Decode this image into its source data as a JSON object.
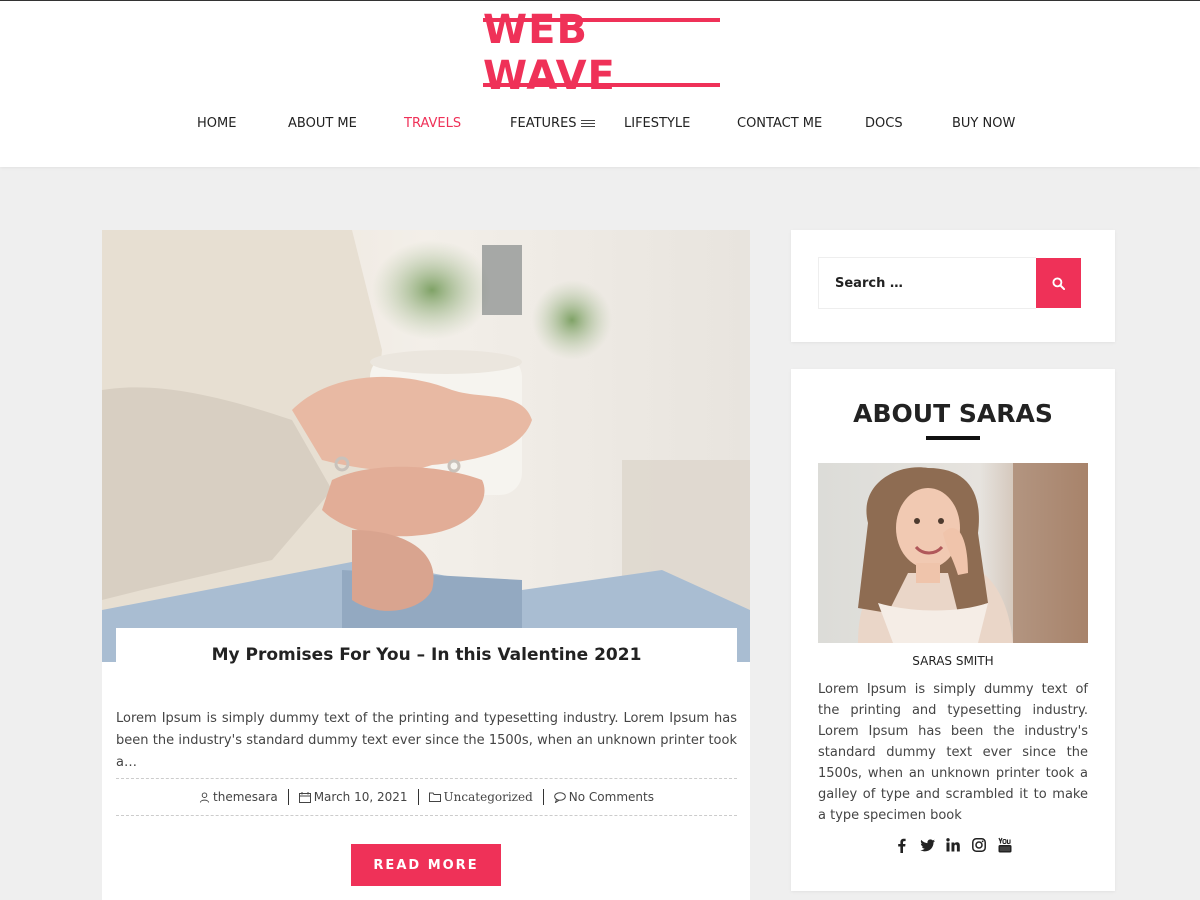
{
  "site": {
    "logo": "WEB WAVE",
    "accent_color": "#ef3158"
  },
  "nav": {
    "items": [
      {
        "label": "HOME"
      },
      {
        "label": "ABOUT ME"
      },
      {
        "label": "TRAVELS",
        "active": true
      },
      {
        "label": "FEATURES",
        "icon": "menu-lines-icon"
      },
      {
        "label": "LIFESTYLE"
      },
      {
        "label": "CONTACT ME"
      },
      {
        "label": "DOCS"
      },
      {
        "label": "BUY NOW"
      }
    ]
  },
  "post": {
    "image_alt": "woman-holding-cup-photo",
    "title": "My Promises For You – In this Valentine 2021",
    "excerpt": "Lorem Ipsum is simply dummy text of the printing and typesetting industry. Lorem Ipsum has been the industry's standard dummy text ever since the 1500s, when an unknown printer took a…",
    "meta": {
      "author": "themesara",
      "date": "March 10, 2021",
      "category": "Uncategorized",
      "comments": "No Comments"
    },
    "read_more": "READ MORE"
  },
  "sidebar": {
    "search": {
      "placeholder": "Search …",
      "button_icon": "search-icon"
    },
    "about": {
      "title": "ABOUT SARAS",
      "name": "SARAS SMITH",
      "text": "Lorem Ipsum is simply dummy text of the printing and typesetting industry. Lorem Ipsum has been the industry's standard dummy text ever since the 1500s, when an unknown printer took a galley of type and scrambled it to make a type specimen book",
      "social": [
        "facebook-icon",
        "twitter-icon",
        "linkedin-icon",
        "instagram-icon",
        "youtube-icon"
      ]
    }
  }
}
